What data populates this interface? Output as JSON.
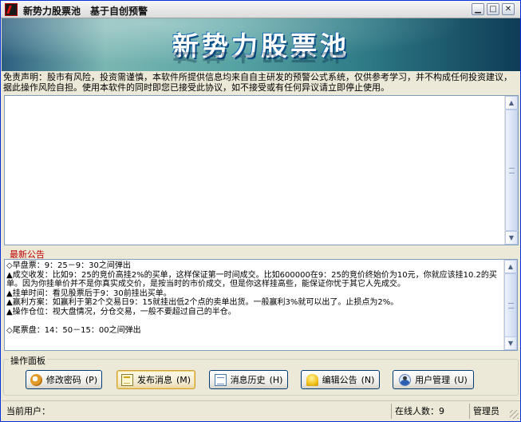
{
  "window": {
    "title": "新势力股票池　基于自创预警",
    "controls": {
      "minimize": "▁",
      "maximize": "□",
      "close": "✕"
    }
  },
  "banner": {
    "title": "新势力股票池"
  },
  "disclaimer": "免责声明：股市有风险，投资需谨慎，本软件所提供信息均来自自主研发的预警公式系统，仅供参考学习，并不构成任何投资建议，据此操作风险自担。使用本软件的同时即您已接受此协议，如不接受或有任何异议请立即停止使用。",
  "message_area": {
    "value": ""
  },
  "notices": {
    "label": "最新公告",
    "lines": [
      "◇早盘票：9：25－9：30之间弹出",
      "▲成交收发：比如9：25的竞价高挂2%的买单，这样保证第一时间成交。比如600000在9：25的竞价终始价为10元，你就应该挂10.2的买单。因为你挂单价并不是你真实成交价，是按当时的市价成交，但是你这样挂高些，能保证你忧于其它人先成交。",
      "▲挂单时间：看见股票后于9：30前挂出买单。",
      "▲赢利方案：如赢利于第2个交易日9：15就挂出低2个点的卖单出货。一般赢利3%就可以出了。止损点为2%。",
      "▲操作仓位：视大盘情况，分仓交易，一般不要超过自己的半仓。",
      "",
      "◇尾票盘：14：50－15：00之间弹出"
    ]
  },
  "operation_panel": {
    "label": "操作面板",
    "buttons": [
      {
        "label": "修改密码",
        "hotkey": "(P)",
        "icon": "key-icon"
      },
      {
        "label": "发布消息",
        "hotkey": "(M)",
        "icon": "post-note-icon"
      },
      {
        "label": "消息历史",
        "hotkey": "(H)",
        "icon": "document-icon"
      },
      {
        "label": "编辑公告",
        "hotkey": "(N)",
        "icon": "bell-icon"
      },
      {
        "label": "用户管理",
        "hotkey": "(U)",
        "icon": "user-icon"
      }
    ]
  },
  "statusbar": {
    "current_user_label": "当前用户：",
    "current_user_value": "",
    "online_label": "在线人数：",
    "online_count": "9",
    "role": "管理员"
  }
}
